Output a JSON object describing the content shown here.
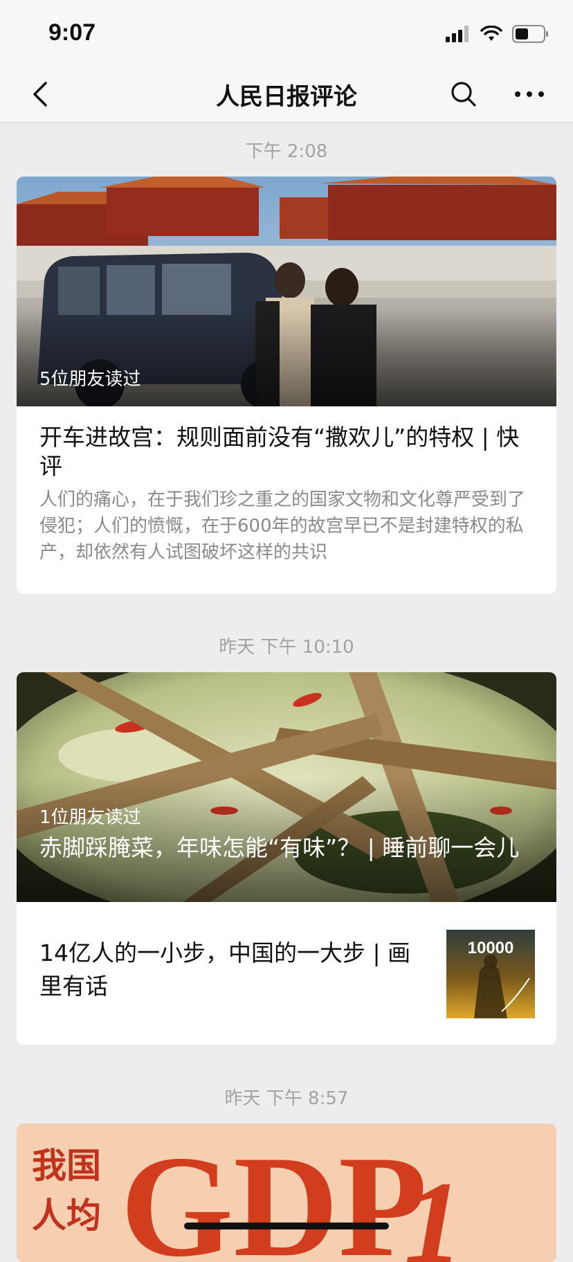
{
  "status_bar": {
    "time": "9:07"
  },
  "nav": {
    "title": "人民日报评论"
  },
  "feed": [
    {
      "timestamp": "下午 2:08",
      "read_count": "5位朋友读过",
      "title": "开车进故宫：规则面前没有“撒欢儿”的特权 | 快评",
      "digest": "人们的痛心，在于我们珍之重之的国家文物和文化尊严受到了侵犯；人们的愤慨，在于600年的故宫早已不是封建特权的私产，却依然有人试图破坏这样的共识"
    },
    {
      "timestamp": "昨天 下午 10:10",
      "read_count": "1位朋友读过",
      "title": "赤脚踩腌菜，年味怎能“有味”？ | 睡前聊一会儿",
      "sub_title": "14亿人的一小步，中国的一大步 | 画里有话",
      "thumb_text": "10000"
    },
    {
      "timestamp": "昨天 下午 8:57",
      "cover_text_line1": "我国",
      "cover_text_line2": "人均",
      "cover_big": "GDP",
      "cover_digit": "1"
    }
  ]
}
